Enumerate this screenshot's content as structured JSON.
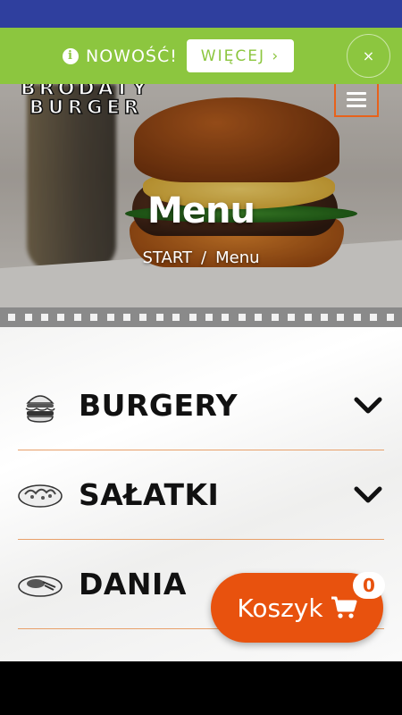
{
  "notice": {
    "text": "NOWOŚĆ!",
    "more_label": "WIĘCEJ ›",
    "close_label": "×"
  },
  "brand": {
    "line1": "BRODATY",
    "line2": "BURGER"
  },
  "hero": {
    "title": "Menu",
    "breadcrumb": {
      "home": "START",
      "separator": "/",
      "current": "Menu"
    }
  },
  "categories": [
    {
      "label": "BURGERY",
      "icon": "burger-icon"
    },
    {
      "label": "SAŁATKI",
      "icon": "salad-icon"
    },
    {
      "label": "DANIA",
      "icon": "dish-icon"
    }
  ],
  "cart": {
    "label": "Koszyk",
    "count": "0",
    "icon": "cart-icon"
  },
  "colors": {
    "status_bar": "#2f3f9e",
    "notice_bar": "#8cc63f",
    "accent": "#e8520e",
    "divider": "#e8a06a"
  }
}
